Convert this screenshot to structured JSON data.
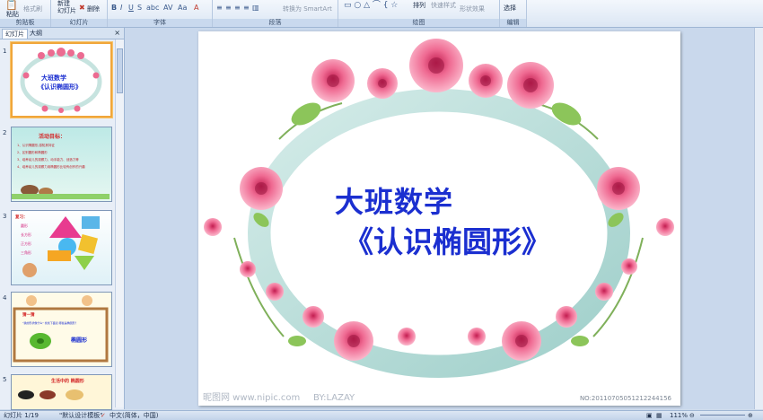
{
  "ribbon": {
    "clipboard": {
      "label": "剪贴板",
      "paste": "粘贴",
      "format_painter": "格式刷"
    },
    "slides": {
      "label": "幻灯片",
      "new_slide": "新建\n幻灯片",
      "delete": "删除"
    },
    "font": {
      "label": "字体"
    },
    "paragraph": {
      "label": "段落",
      "convert_smartart": "转换为 SmartArt"
    },
    "drawing": {
      "label": "绘图",
      "arrange": "排列",
      "quick_styles": "快速样式",
      "shape_effects": "形状效果"
    },
    "editing": {
      "label": "编辑",
      "select": "选择"
    }
  },
  "panel": {
    "tab_slides": "幻灯片",
    "tab_outline": "大纲",
    "close": "×",
    "thumbnails": [
      {
        "num": "1",
        "line1": "大班数学",
        "line2": "《认识椭圆形》"
      },
      {
        "num": "2",
        "title": "活动目标：",
        "items": [
          "1、认识椭圆形,感知其特征",
          "2、区别圆形和椭圆形",
          "3、培养幼儿的观察力、动手能力、创造力等",
          "4、培养幼儿的观察力用椭圆形比较有创作的兴趣"
        ]
      },
      {
        "num": "3",
        "title": "复习：",
        "items": [
          "圆形",
          "长方形",
          "正方形",
          "三角形"
        ]
      },
      {
        "num": "4",
        "title": "猜一猜",
        "subtitle": "\"我的形状像什么\" 找找下面表 哪些是椭圆形？",
        "shape_label": "椭圆形"
      },
      {
        "num": "5",
        "title": "生活中的 椭圆形"
      }
    ]
  },
  "slide": {
    "title_line1": "大班数学",
    "title_line2": "《认识椭圆形》",
    "watermark": "昵图网 www.nipic.com",
    "watermark_by": "BY:LAZAY",
    "watermark_id": "NO:20110705051212244156"
  },
  "status": {
    "slide_info": "幻灯片 1/19",
    "theme": "\"默认设计模板\"",
    "language": "中文(简体，中国)",
    "zoom": "111%"
  },
  "colors": {
    "title": "#1b2fd0",
    "frame": "#b8d9d6",
    "rose": "#e95a84"
  }
}
